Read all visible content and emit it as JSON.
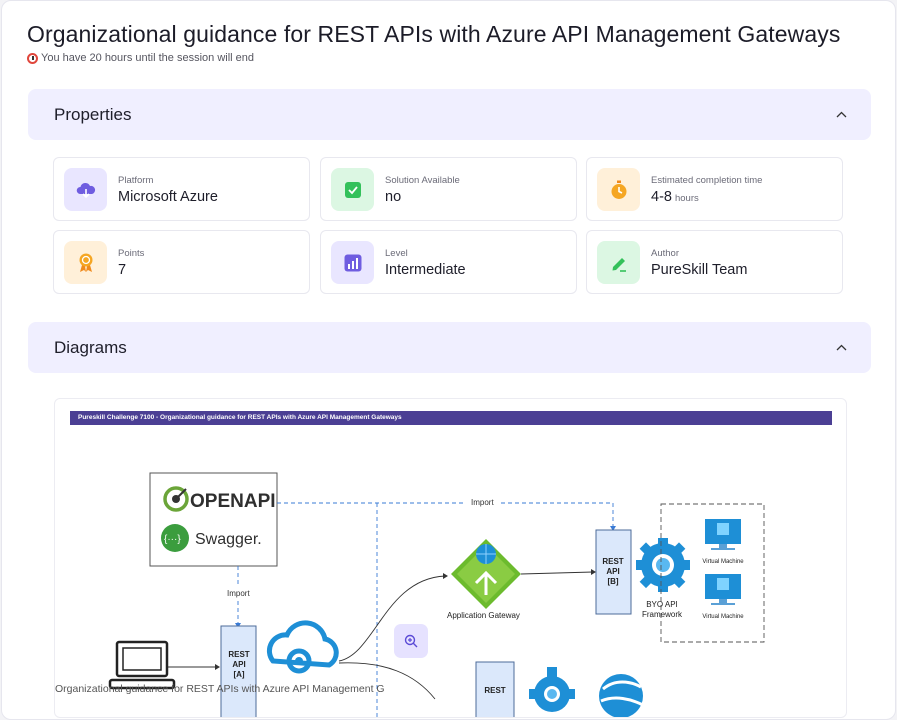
{
  "header": {
    "title": "Organizational guidance for REST APIs with Azure API Management Gateways",
    "session_text": "You have 20 hours until the session will end"
  },
  "properties": {
    "section_label": "Properties",
    "tiles": [
      {
        "caption": "Platform",
        "value": "Microsoft Azure",
        "icon": "cloud-download-icon",
        "color": "#e9e6ff"
      },
      {
        "caption": "Solution Available",
        "value": "no",
        "icon": "checkbox-icon",
        "color": "#dcf7e3"
      },
      {
        "caption": "Estimated completion time",
        "value": "4-8",
        "unit": "hours",
        "icon": "stopwatch-icon",
        "color": "#fff0d9"
      },
      {
        "caption": "Points",
        "value": "7",
        "icon": "award-icon",
        "color": "#fff0d9"
      },
      {
        "caption": "Level",
        "value": "Intermediate",
        "icon": "bar-chart-icon",
        "color": "#e9e6ff"
      },
      {
        "caption": "Author",
        "value": "PureSkill Team",
        "icon": "pen-icon",
        "color": "#dcf7e3"
      }
    ]
  },
  "diagrams": {
    "section_label": "Diagrams",
    "caption": "Organizational guidance for REST APIs with Azure API Management G",
    "figure": {
      "banner": "Pureskill Challenge 7100 - Organizational guidance for REST APIs with Azure API Management Gateways",
      "openapi_label": "OPENAPI",
      "swagger_label": "Swagger.",
      "import_top": "Import",
      "import_left": "Import",
      "gateway_label": "Application Gateway",
      "rest_a": [
        "REST",
        "API",
        "[A]"
      ],
      "rest_b": [
        "REST",
        "API",
        "[B]"
      ],
      "rest_c": "REST",
      "byo_label": [
        "BYO API",
        "Framework"
      ],
      "vm_label": "Virtual Machine"
    }
  },
  "colors": {
    "accent": "#4b3f94",
    "section_bg": "#f0efff",
    "azure_blue": "#1e8fd6",
    "gateway_green": "#6cbb2d"
  }
}
